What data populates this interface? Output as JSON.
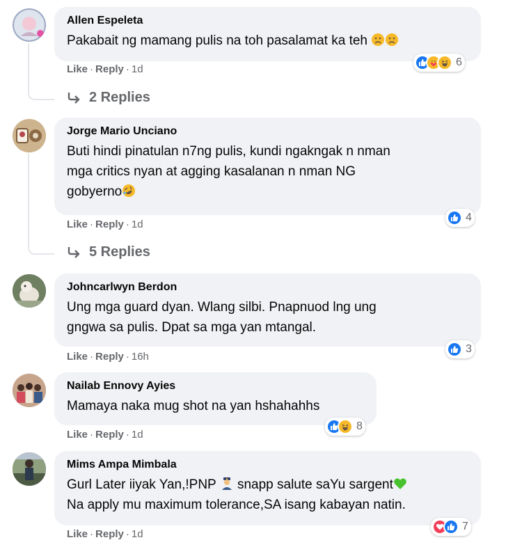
{
  "actions": {
    "like": "Like",
    "reply": "Reply"
  },
  "comments": [
    {
      "name": "Allen Espeleta",
      "lines": [
        "Pakabait ng mamang pulis na toh pasalamat ka teh"
      ],
      "time": "1d",
      "reaction_count": "6",
      "reactions": [
        "like-icon",
        "care-icon",
        "haha-icon"
      ],
      "replies": "2 Replies"
    },
    {
      "name": "Jorge Mario Unciano",
      "lines": [
        "Buti hindi pinatulan n7ng pulis, kundi ngakngak n nman",
        "mga critics nyan at agging kasalanan n nman NG",
        "gobyerno"
      ],
      "time": "1d",
      "reaction_count": "4",
      "reactions": [
        "like-icon"
      ],
      "replies": "5 Replies"
    },
    {
      "name": "Johncarlwyn Berdon",
      "lines": [
        "Ung mga guard dyan. Wlang silbi. Pnapnuod lng ung",
        "gngwa sa pulis. Dpat sa mga yan mtangal."
      ],
      "time": "16h",
      "reaction_count": "3",
      "reactions": [
        "like-icon"
      ]
    },
    {
      "name": "Nailab Ennovy Ayies",
      "lines": [
        "Mamaya naka mug shot na yan hshahahhs"
      ],
      "time": "1d",
      "reaction_count": "8",
      "reactions": [
        "like-icon",
        "haha-icon"
      ]
    },
    {
      "name": "Mims Ampa Mimbala",
      "lines": [
        "Gurl Later iiyak Yan,!PNP",
        "snapp salute saYu sargent",
        "Na apply mu maximum tolerance,SA isang kabayan natin."
      ],
      "time": "1d",
      "reaction_count": "7",
      "reactions": [
        "love-icon",
        "like-icon"
      ]
    }
  ],
  "colors": {
    "like": "#1877f2",
    "love": "#f33e58",
    "haha": "#f7b928",
    "bubble": "#f0f2f5",
    "meta": "#65676b"
  }
}
